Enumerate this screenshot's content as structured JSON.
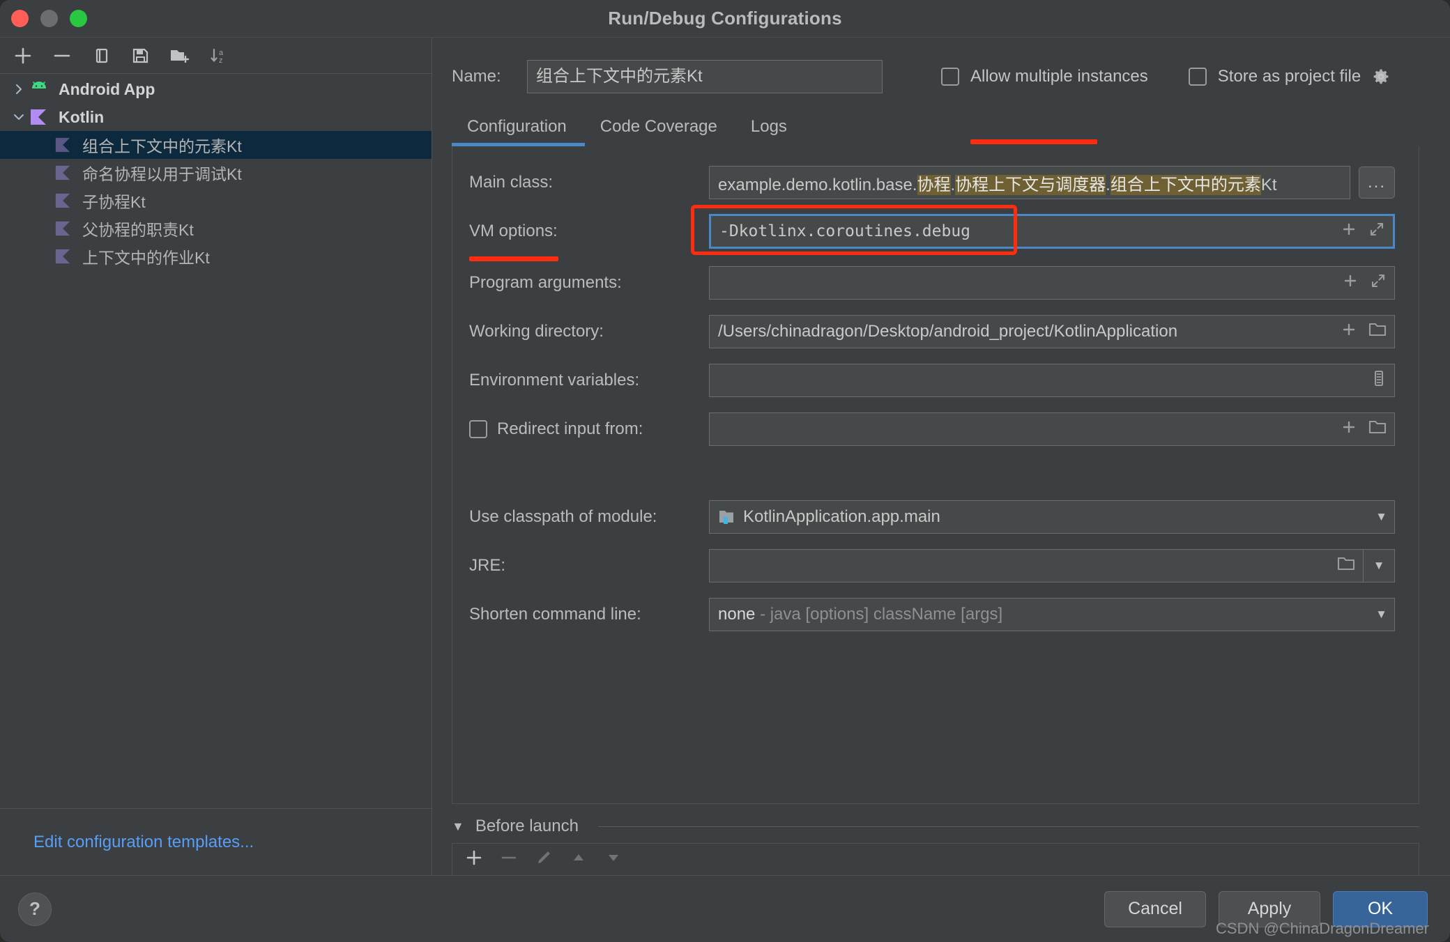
{
  "window": {
    "title": "Run/Debug Configurations",
    "traffic_lights": [
      "close",
      "minimize",
      "zoom"
    ]
  },
  "sidebar": {
    "toolbar": [
      {
        "name": "add-configuration-button",
        "icon": "plus-icon"
      },
      {
        "name": "remove-configuration-button",
        "icon": "minus-icon"
      },
      {
        "name": "copy-configuration-button",
        "icon": "copy-icon"
      },
      {
        "name": "save-configuration-button",
        "icon": "save-icon"
      },
      {
        "name": "move-into-folder-button",
        "icon": "new-folder-icon"
      },
      {
        "name": "sort-configurations-button",
        "icon": "sort-az-icon"
      }
    ],
    "tree": [
      {
        "label": "Android App",
        "type": "group",
        "icon": "android-icon",
        "expanded": false,
        "selected": false
      },
      {
        "label": "Kotlin",
        "type": "group",
        "icon": "kotlin-icon",
        "expanded": true,
        "selected": false
      },
      {
        "label": "组合上下文中的元素Kt",
        "type": "child",
        "icon": "kotlin-file-icon",
        "selected": true
      },
      {
        "label": "命名协程以用于调试Kt",
        "type": "child",
        "icon": "kotlin-file-icon",
        "selected": false
      },
      {
        "label": "子协程Kt",
        "type": "child",
        "icon": "kotlin-file-icon",
        "selected": false
      },
      {
        "label": "父协程的职责Kt",
        "type": "child",
        "icon": "kotlin-file-icon",
        "selected": false
      },
      {
        "label": "上下文中的作业Kt",
        "type": "child",
        "icon": "kotlin-file-icon",
        "selected": false
      }
    ],
    "edit_templates_link": "Edit configuration templates..."
  },
  "header": {
    "name_label": "Name:",
    "name_value": "组合上下文中的元素Kt",
    "allow_multiple_instances_label": "Allow multiple instances",
    "allow_multiple_instances_checked": false,
    "store_as_project_file_label": "Store as project file",
    "store_as_project_file_checked": false,
    "gear_icon": "gear-icon"
  },
  "tabs": [
    {
      "label": "Configuration",
      "active": true
    },
    {
      "label": "Code Coverage",
      "active": false
    },
    {
      "label": "Logs",
      "active": false
    }
  ],
  "form": {
    "main_class": {
      "label": "Main class:",
      "prefix": "example.demo.kotlin.base.",
      "segments": [
        "协程",
        "协程上下文与调度器",
        "组合上下文中的元素"
      ],
      "suffix": "Kt",
      "browse_label": "..."
    },
    "vm_options": {
      "label": "VM options:",
      "value": "-Dkotlinx.coroutines.debug",
      "focused": true,
      "annotated": true
    },
    "program_arguments": {
      "label": "Program arguments:",
      "value": ""
    },
    "working_directory": {
      "label": "Working directory:",
      "value": "/Users/chinadragon/Desktop/android_project/KotlinApplication"
    },
    "environment_variables": {
      "label": "Environment variables:",
      "value": ""
    },
    "redirect_input_from": {
      "label": "Redirect input from:",
      "value": "",
      "checked": false
    },
    "use_classpath_of_module": {
      "label": "Use classpath of module:",
      "value": "KotlinApplication.app.main",
      "icon": "module-icon"
    },
    "jre": {
      "label": "JRE:",
      "value": ""
    },
    "shorten_command_line": {
      "label": "Shorten command line:",
      "value": "none",
      "hint": "- java [options] className [args]"
    }
  },
  "before_launch": {
    "title": "Before launch",
    "expanded": true,
    "toolbar": [
      {
        "name": "add-task-button",
        "icon": "plus-icon",
        "enabled": true
      },
      {
        "name": "remove-task-button",
        "icon": "minus-icon",
        "enabled": false
      },
      {
        "name": "edit-task-button",
        "icon": "pencil-icon",
        "enabled": false
      },
      {
        "name": "move-task-up-button",
        "icon": "triangle-up-icon",
        "enabled": false
      },
      {
        "name": "move-task-down-button",
        "icon": "triangle-down-icon",
        "enabled": false
      }
    ]
  },
  "footer": {
    "help_label": "?",
    "cancel_label": "Cancel",
    "apply_label": "Apply",
    "ok_label": "OK",
    "watermark": "CSDN @ChinaDragonDreamer"
  },
  "colors": {
    "accent_blue": "#4a88c7",
    "annotation_red": "#ff2d0e",
    "link_blue": "#589df6",
    "selection_navy": "#0d293e",
    "highlight_olive": "#6e6033",
    "primary_button": "#37659a"
  }
}
